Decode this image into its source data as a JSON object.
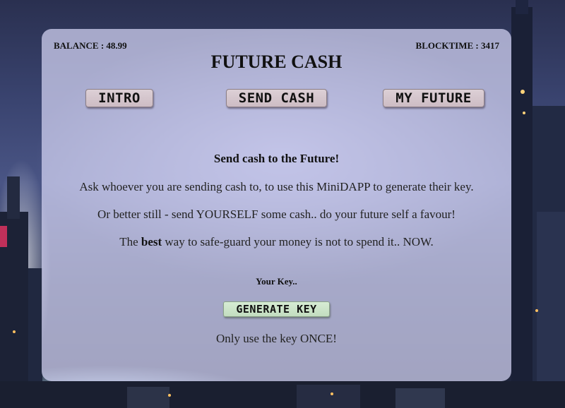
{
  "header": {
    "balance_label": "BALANCE : 48.99",
    "blocktime_label": "BLOCKTIME : 3417",
    "title": "FUTURE CASH"
  },
  "nav": {
    "intro_label": "INTRO",
    "send_cash_label": "SEND CASH",
    "my_future_label": "MY FUTURE"
  },
  "content": {
    "subtitle": "Send cash to the Future!",
    "paragraph_1": "Ask whoever you are sending cash to, to use this MiniDAPP to generate their key.",
    "paragraph_2": "Or better still - send YOURSELF some cash.. do your future self a favour!",
    "paragraph_3_pre": "The ",
    "paragraph_3_bold": "best",
    "paragraph_3_post": " way to safe-guard your money is not to spend it.. NOW.",
    "key_label": "Your Key..",
    "generate_key_label": "GENERATE KEY",
    "warning": "Only use the key ONCE!"
  },
  "colors": {
    "panel_bg": "#d6d6f5",
    "nav_button_bg": "#d6c8ce",
    "generate_button_bg": "#cfe6cc"
  }
}
